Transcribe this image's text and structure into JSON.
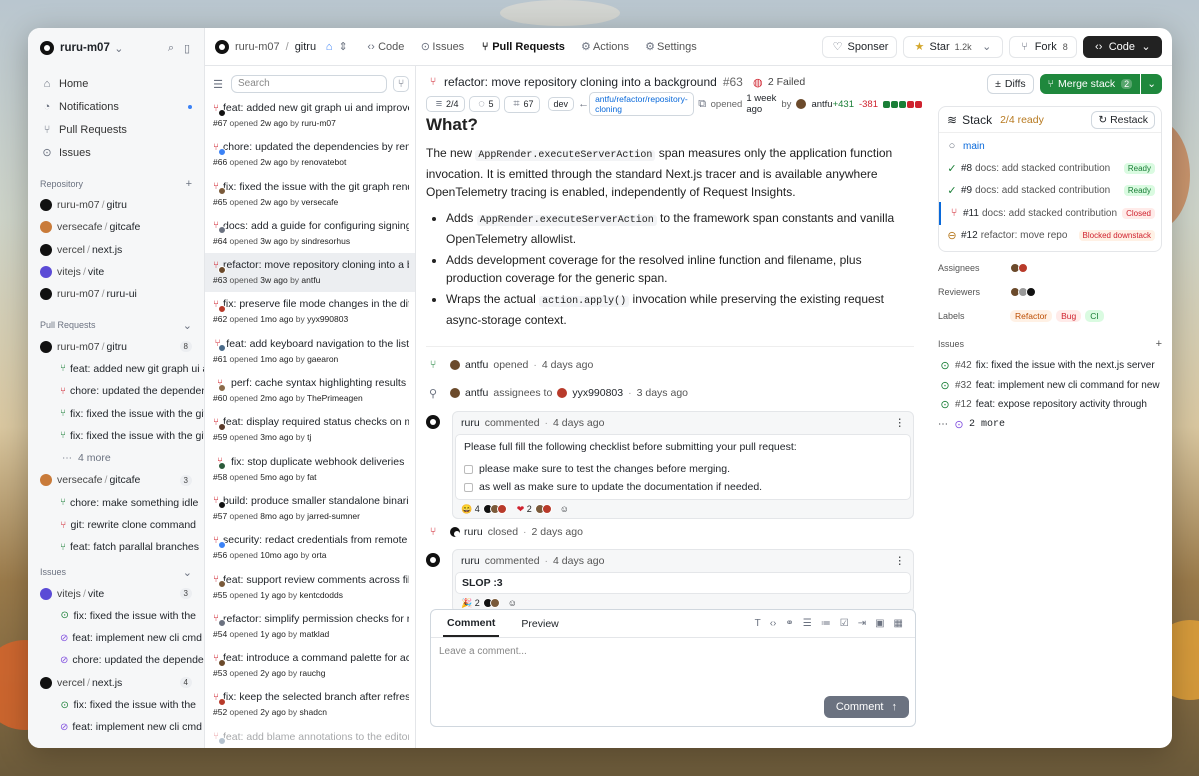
{
  "user": {
    "name": "ruru-m07"
  },
  "nav": [
    {
      "label": "Home"
    },
    {
      "label": "Notifications"
    },
    {
      "label": "Pull Requests"
    },
    {
      "label": "Issues"
    }
  ],
  "repo_section": {
    "title": "Repository",
    "items": [
      {
        "owner": "ruru-m07",
        "name": "gitru",
        "color": "#111"
      },
      {
        "owner": "versecafe",
        "name": "gitcafe",
        "color": "#c97b3a"
      },
      {
        "owner": "vercel",
        "name": "next.js",
        "color": "#111"
      },
      {
        "owner": "vitejs",
        "name": "vite",
        "color": "#5b4bd6"
      },
      {
        "owner": "ruru-m07",
        "name": "ruru-ui",
        "color": "#111"
      }
    ]
  },
  "pr_section": {
    "title": "Pull Requests",
    "groups": [
      {
        "owner": "ruru-m07",
        "name": "gitru",
        "count": "8",
        "color": "#111",
        "items": [
          {
            "title": "feat: added new git graph ui and improv",
            "state": "open"
          },
          {
            "title": "chore: updated the dependencies",
            "state": "closed"
          },
          {
            "title": "fix: fixed the issue with the git graph",
            "state": "open"
          },
          {
            "title": "fix: fixed the issue with the git graph",
            "state": "open"
          }
        ],
        "more": "4 more"
      },
      {
        "owner": "versecafe",
        "name": "gitcafe",
        "count": "3",
        "color": "#c97b3a",
        "items": [
          {
            "title": "chore: make something idle",
            "state": "open"
          },
          {
            "title": "git: rewrite clone command",
            "state": "closed"
          },
          {
            "title": "feat: fatch parallal branches",
            "state": "open"
          }
        ]
      }
    ]
  },
  "issues_section": {
    "title": "Issues",
    "groups": [
      {
        "owner": "vitejs",
        "name": "vite",
        "count": "3",
        "color": "#5b4bd6",
        "items": [
          {
            "title": "fix: fixed the issue with the",
            "state": "open"
          },
          {
            "title": "feat: implement new cli cmd",
            "state": "closed"
          },
          {
            "title": "chore: updated the dependencies",
            "state": "closed"
          }
        ]
      },
      {
        "owner": "vercel",
        "name": "next.js",
        "count": "4",
        "color": "#111",
        "items": [
          {
            "title": "fix: fixed the issue with the",
            "state": "open"
          },
          {
            "title": "feat: implement new cli cmd",
            "state": "closed"
          }
        ]
      }
    ]
  },
  "header": {
    "owner": "ruru-m07",
    "repo": "gitru",
    "tabs": [
      "Code",
      "Issues",
      "Pull Requests",
      "Actions",
      "Settings"
    ],
    "sponsor": "Sponser",
    "star": "Star",
    "star_count": "1.2k",
    "fork": "Fork",
    "fork_count": "8",
    "code": "Code"
  },
  "search": {
    "placeholder": "Search"
  },
  "prs": [
    {
      "title": "feat: added new git graph ui and improvements",
      "num": "#67",
      "age": "2w ago",
      "author": "ruru-m07"
    },
    {
      "title": "chore: updated the dependencies by renovate",
      "num": "#66",
      "age": "2w ago",
      "author": "renovatebot"
    },
    {
      "title": "fix: fixed the issue with the git graph rendering",
      "num": "#65",
      "age": "2w ago",
      "author": "versecafe"
    },
    {
      "title": "docs: add a guide for configuring signing",
      "num": "#64",
      "age": "3w ago",
      "author": "sindresorhus"
    },
    {
      "title": "refactor: move repository cloning into a background",
      "num": "#63",
      "age": "3w ago",
      "author": "antfu",
      "selected": true
    },
    {
      "title": "fix: preserve file mode changes in the diff",
      "num": "#62",
      "age": "1mo ago",
      "author": "yyx990803"
    },
    {
      "title": "feat: add keyboard navigation to the list",
      "num": "#61",
      "age": "1mo ago",
      "author": "gaearon"
    },
    {
      "title": "perf: cache syntax highlighting results",
      "num": "#60",
      "age": "2mo ago",
      "author": "ThePrimeagen"
    },
    {
      "title": "feat: display required status checks on merge",
      "num": "#59",
      "age": "3mo ago",
      "author": "tj"
    },
    {
      "title": "fix: stop duplicate webhook deliveries",
      "num": "#58",
      "age": "5mo ago",
      "author": "fat"
    },
    {
      "title": "build: produce smaller standalone binaries",
      "num": "#57",
      "age": "8mo ago",
      "author": "jarred-sumner"
    },
    {
      "title": "security: redact credentials from remote urls",
      "num": "#56",
      "age": "10mo ago",
      "author": "orta"
    },
    {
      "title": "feat: support review comments across files",
      "num": "#55",
      "age": "1y ago",
      "author": "kentcdodds"
    },
    {
      "title": "refactor: simplify permission checks for repos",
      "num": "#54",
      "age": "1y ago",
      "author": "matklad"
    },
    {
      "title": "feat: introduce a command palette for actions",
      "num": "#53",
      "age": "2y ago",
      "author": "rauchg"
    },
    {
      "title": "fix: keep the selected branch after refresh",
      "num": "#52",
      "age": "2y ago",
      "author": "shadcn"
    },
    {
      "title": "feat: add blame annotations to the editor",
      "num": "",
      "age": "",
      "author": ""
    }
  ],
  "pr": {
    "title": "refactor: move repository cloning into a background",
    "num": "#63",
    "checks": "2 Failed",
    "commits": "2/4",
    "comments": "5",
    "files": "67",
    "base": "dev",
    "head": "antfu/refactor/repository-cloning",
    "opened": "opened",
    "age": "1 week ago",
    "by": "by",
    "author": "antfu",
    "additions": "+431",
    "deletions": "-381"
  },
  "desc": {
    "heading": "What?",
    "p1a": "The new ",
    "p1code": "AppRender.executeServerAction",
    "p1b": " span measures only the application function invocation. It is emitted through the standard Next.js tracer and is available anywhere OpenTelemetry tracing is enabled, independently of Request Insights.",
    "b1a": "Adds ",
    "b1code": "AppRender.executeServerAction",
    "b1b": " to the framework span constants and vanilla OpenTelemetry allowlist.",
    "b2": "Adds development coverage for the resolved inline function and filename, plus production coverage for the generic span.",
    "b3a": "Wraps the actual ",
    "b3code": "action.apply()",
    "b3b": " invocation while preserving the existing request async-storage context."
  },
  "timeline": [
    {
      "user": "antfu",
      "action": "opened",
      "age": "4 days ago"
    },
    {
      "user": "antfu",
      "action": "assignees to",
      "target": "yyx990803",
      "age": "3 days ago"
    }
  ],
  "comment1": {
    "user": "ruru",
    "action": "commented",
    "age": "4 days ago",
    "body": "Please full fill the following checklist before submitting your pull request:",
    "check1": "please make sure to test the changes before merging.",
    "check2": "as well as make sure to update the documentation if needed.",
    "r1": "4",
    "r2": "2"
  },
  "closed": {
    "user": "ruru",
    "action": "closed",
    "age": "2 days ago"
  },
  "comment2": {
    "user": "ruru",
    "action": "commented",
    "age": "4 days ago",
    "body": "SLOP :3",
    "r1": "2"
  },
  "editor": {
    "tab1": "Comment",
    "tab2": "Preview",
    "placeholder": "Leave a comment...",
    "submit": "Comment"
  },
  "right": {
    "diffs": "Diffs",
    "merge": "Merge stack",
    "merge_count": "2",
    "stack_title": "Stack",
    "stack_ready": "2/4 ready",
    "restack": "Restack",
    "stack": [
      {
        "label": "main",
        "status": ""
      },
      {
        "num": "#8",
        "label": "docs: add stacked contribution",
        "status": "Ready"
      },
      {
        "num": "#9",
        "label": "docs: add stacked contribution",
        "status": "Ready"
      },
      {
        "num": "#11",
        "label": "docs: add stacked contribution",
        "status": "Closed"
      },
      {
        "num": "#12",
        "label": "refactor: move repo",
        "status": "Blocked downstack"
      }
    ],
    "assignees": "Assignees",
    "reviewers": "Reviewers",
    "labels": "Labels",
    "label_items": [
      "Refactor",
      "Bug",
      "CI"
    ],
    "issues_title": "Issues",
    "issues": [
      {
        "num": "#42",
        "title": "fix: fixed the issue with the next.js server"
      },
      {
        "num": "#32",
        "title": "feat: implement new cli command for new"
      },
      {
        "num": "#12",
        "title": "feat: expose repository activity through"
      }
    ],
    "more": "2 more"
  },
  "colors": {
    "open": "#1a7f37",
    "closed": "#cf222e",
    "accent": "#1f883d"
  }
}
